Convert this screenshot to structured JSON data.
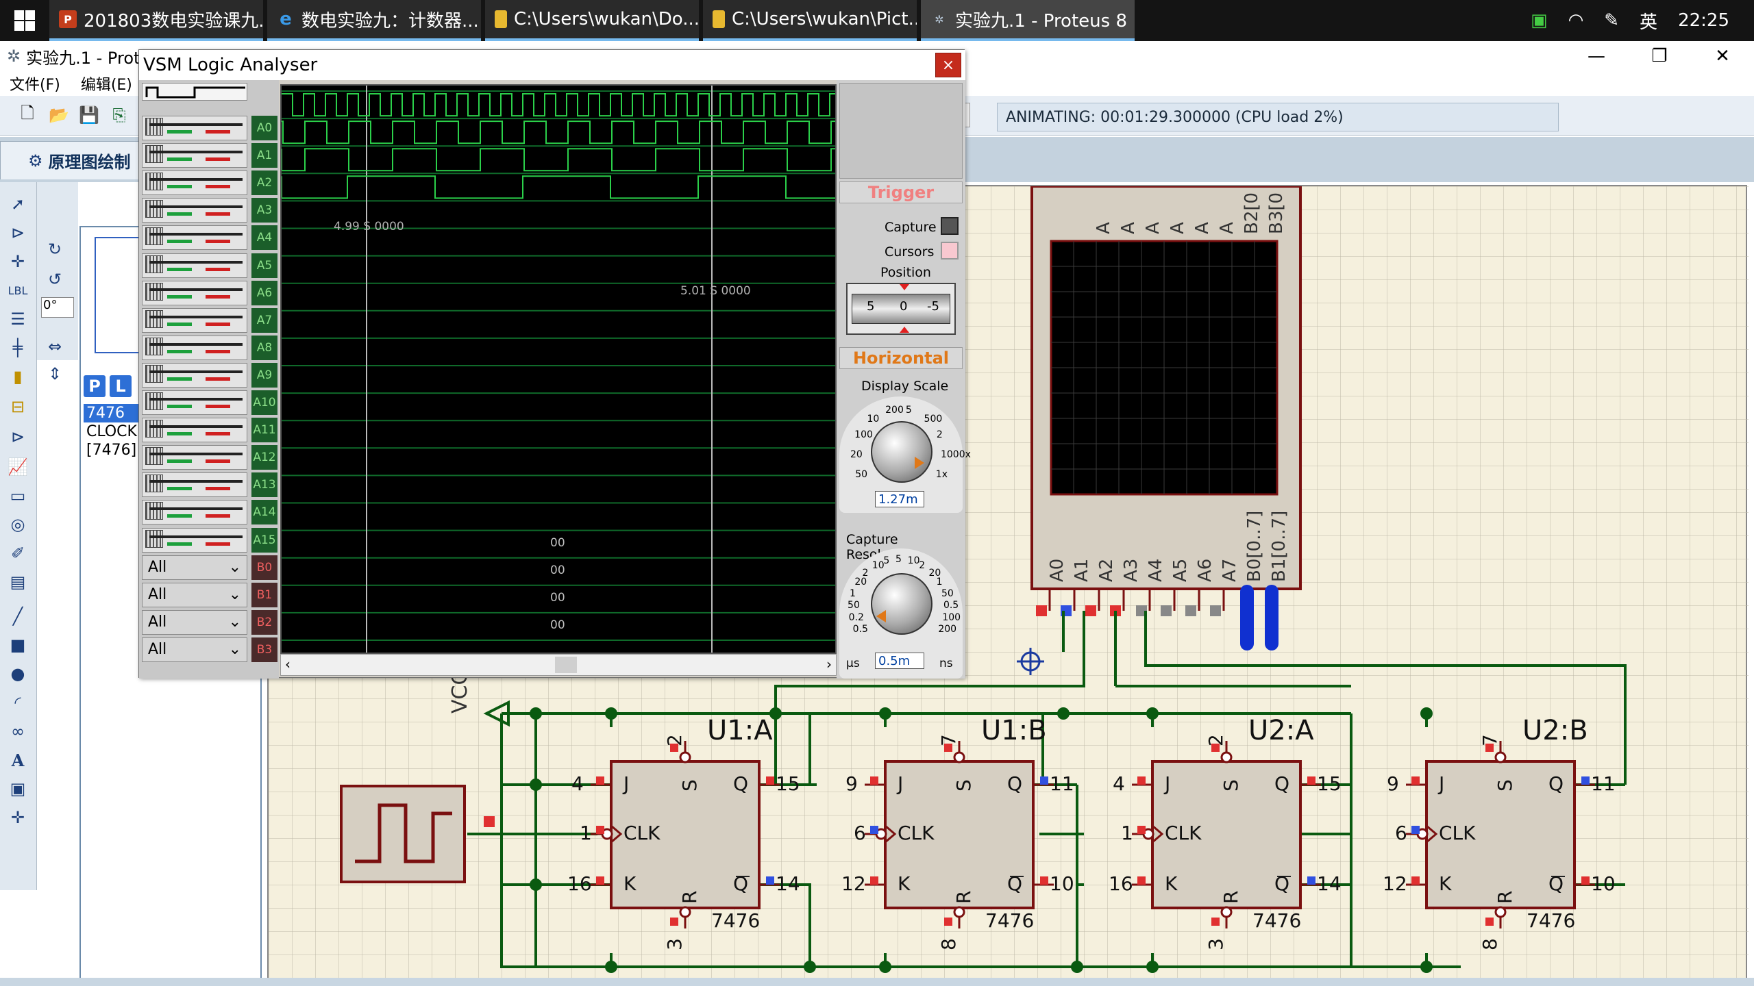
{
  "taskbar": {
    "tasks": [
      {
        "label": "201803数电实验课九...",
        "icon": "powerpoint-icon",
        "color": "#c43e1c"
      },
      {
        "label": "数电实验九：计数器...",
        "icon": "edge-icon",
        "color": "#1f7ad6"
      },
      {
        "label": "C:\\Users\\wukan\\Do...",
        "icon": "folder-icon",
        "color": "#e8b930"
      },
      {
        "label": "C:\\Users\\wukan\\Pict...",
        "icon": "folder-icon",
        "color": "#e8b930"
      },
      {
        "label": "实验九.1 - Proteus 8 ...",
        "icon": "proteus-icon",
        "color": "#8090a0"
      }
    ],
    "ime": "英",
    "time": "22:25"
  },
  "app": {
    "title": "实验九.1 - Prot",
    "menu": [
      "文件(F)",
      "编辑(E)"
    ],
    "status": "ANIMATING: 00:01:29.300000 (CPU load 2%)",
    "tab": "原理图绘制",
    "rotation": "0°",
    "pick_p": "P",
    "pick_l": "L",
    "objects": [
      "7476",
      "CLOCK",
      "[7476]"
    ]
  },
  "vsm": {
    "title": "VSM Logic Analyser",
    "close": "×",
    "channels": [
      "A0",
      "A1",
      "A2",
      "A3",
      "A4",
      "A5",
      "A6",
      "A7",
      "A8",
      "A9",
      "A10",
      "A11",
      "A12",
      "A13",
      "A14",
      "A15"
    ],
    "bus_channels": [
      "B0",
      "B1",
      "B2",
      "B3"
    ],
    "bus_mode": "All",
    "bus_values": [
      "00",
      "00",
      "00",
      "00"
    ],
    "cursor1": "4.99 S 0000",
    "cursor2": "5.01 S 0000",
    "trigger_title": "Trigger",
    "capture_label": "Capture",
    "cursors_label": "Cursors",
    "position_label": "Position",
    "position_scale": [
      "5",
      "0",
      "-5"
    ],
    "horizontal_title": "Horizontal",
    "display_scale_label": "Display Scale",
    "display_scale_ticks": [
      "50",
      "20",
      "100",
      "10",
      "200",
      "5",
      "500",
      "2",
      "1000x",
      "1x"
    ],
    "display_scale_value": "1.27m",
    "capture_res_label": "Capture Resolution",
    "capture_res_ticks": [
      "0.5",
      "0.2",
      "50",
      "1",
      "20",
      "2",
      "10",
      "5",
      "5",
      "10",
      "2",
      "20",
      "1",
      "50",
      "0.5",
      "100",
      "200"
    ],
    "capture_res_value": "0.5m",
    "unit_left": "µs",
    "unit_right": "ns"
  },
  "schematic": {
    "vcc": "VCC",
    "display_top_pins": [
      "A",
      "A",
      "A",
      "A",
      "A",
      "A",
      "B2[0",
      "B3[0"
    ],
    "display_pins": [
      "A0",
      "A1",
      "A2",
      "A3",
      "A4",
      "A5",
      "A6",
      "A7",
      "B0[0..7]",
      "B1[0..7]"
    ],
    "flipflops": [
      {
        "name": "U1:A",
        "part": "7476",
        "pin_j": "4",
        "pin_clk": "1",
        "pin_k": "16",
        "pin_s": "2",
        "pin_r": "3",
        "pin_q": "15",
        "pin_qb": "14"
      },
      {
        "name": "U1:B",
        "part": "7476",
        "pin_j": "9",
        "pin_clk": "6",
        "pin_k": "12",
        "pin_s": "7",
        "pin_r": "8",
        "pin_q": "11",
        "pin_qb": "10"
      },
      {
        "name": "U2:A",
        "part": "7476",
        "pin_j": "4",
        "pin_clk": "1",
        "pin_k": "16",
        "pin_s": "2",
        "pin_r": "3",
        "pin_q": "15",
        "pin_qb": "14"
      },
      {
        "name": "U2:B",
        "part": "7476",
        "pin_j": "9",
        "pin_clk": "6",
        "pin_k": "12",
        "pin_s": "7",
        "pin_r": "8",
        "pin_q": "11",
        "pin_qb": "10"
      }
    ],
    "ff_labels": {
      "j": "J",
      "k": "K",
      "clk": "CLK",
      "q": "Q",
      "qb": "Q",
      "s": "S",
      "r": "R"
    }
  }
}
